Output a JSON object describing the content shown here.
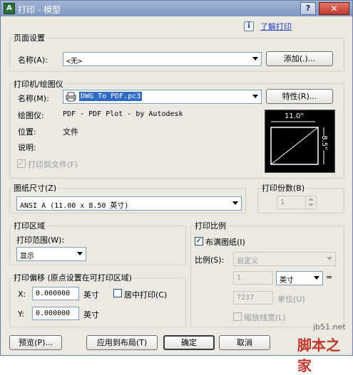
{
  "window": {
    "title": "打印 - 模型",
    "app_icon": "A",
    "help_glyph": "?",
    "close_glyph": "✕"
  },
  "top": {
    "info_glyph": "i",
    "help_link": "了解打印"
  },
  "page_setup": {
    "group_label": "页面设置",
    "name_label": "名称(A):",
    "name_value": "<无>",
    "add_button": "添加(.)..."
  },
  "printer": {
    "group_label": "打印机/绘图仪",
    "name_label": "名称(M):",
    "name_value": "DWG To PDF.pc3",
    "properties_button": "特性(R)...",
    "plotter_label": "绘图仪:",
    "plotter_value": "PDF - PDF Plot - by Autodesk",
    "location_label": "位置:",
    "location_value": "文件",
    "description_label": "说明:",
    "print_to_file_label": "打印到文件(F)",
    "print_to_file_checked": true,
    "preview_width": "11.0\"",
    "preview_height": "8.5\""
  },
  "paper_size": {
    "group_label": "图纸尺寸(Z)",
    "value": "ANSI A (11.00 x 8.50 英寸)"
  },
  "copies": {
    "group_label": "打印份数(B)",
    "value": "1"
  },
  "plot_area": {
    "group_label": "打印区域",
    "range_label": "打印范围(W):",
    "range_value": "显示"
  },
  "plot_offset": {
    "group_label": "打印偏移 (原点设置在可打印区域)",
    "x_label": "X:",
    "x_value": "0.000000",
    "x_unit": "英寸",
    "y_label": "Y:",
    "y_value": "0.000000",
    "y_unit": "英寸",
    "center_label": "居中打印(C)",
    "center_checked": false
  },
  "plot_scale": {
    "group_label": "打印比例",
    "fit_label": "布满图纸(I)",
    "fit_checked": true,
    "scale_label": "比例(S):",
    "scale_value": "自定义",
    "value1": "1",
    "unit_value": "英寸",
    "equals_glyph": "=",
    "value2": "7237",
    "unit2_label": "单位(U)",
    "lineweights_label": "缩放线宽(L)"
  },
  "buttons": {
    "preview": "预览(P)...",
    "apply_layout": "应用到布局(T)",
    "ok": "确定",
    "cancel": "取消"
  },
  "watermark": {
    "site": "jb51.net",
    "brand": "脚本之家"
  }
}
